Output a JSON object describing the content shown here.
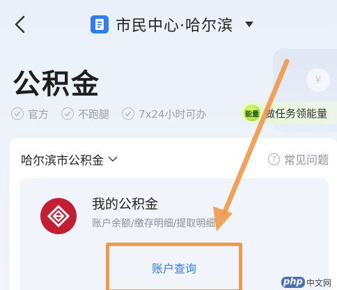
{
  "header": {
    "back_icon": "chevron-left-icon",
    "title": "市民中心·哈尔滨",
    "title_icon": "document-icon",
    "dropdown_icon": "triangle-down-icon"
  },
  "page": {
    "title": "公积金",
    "tags": [
      "官方",
      "不跑腿",
      "7x24小时可办"
    ],
    "task": {
      "badge": "能量",
      "label": "做任务领能量"
    }
  },
  "card": {
    "city_select": "哈尔滨市公积金",
    "faq": "常见问题",
    "service": {
      "title": "我的公积金",
      "subtitle": "账户余额/缴存明细/提取明细",
      "button": "账户查询"
    }
  },
  "watermark": {
    "logo": "php",
    "text": "中文网"
  },
  "colors": {
    "accent_blue": "#2f7cf6",
    "logo_red": "#c21f34",
    "annotation_orange": "#f09a4a"
  }
}
